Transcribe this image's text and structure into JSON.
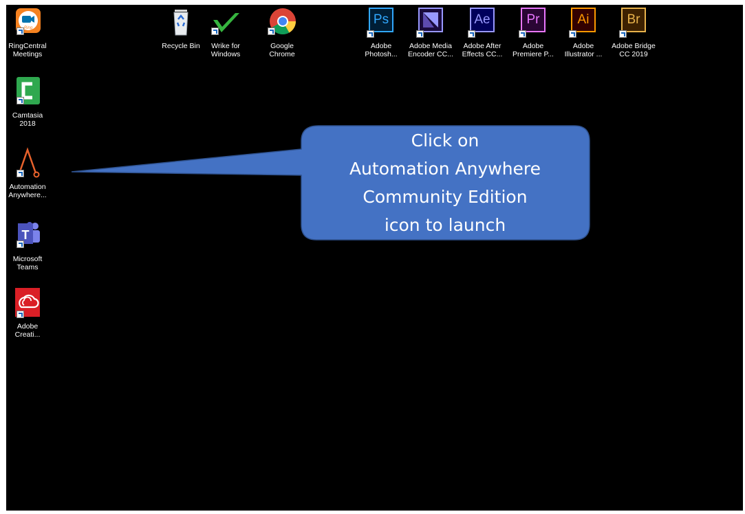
{
  "desktop": {
    "left_icons": [
      {
        "label": "RingCentral\nMeetings",
        "icon": "ringcentral-meetings-icon"
      },
      {
        "label": "Camtasia\n2018",
        "icon": "camtasia-icon"
      },
      {
        "label": "Automation\nAnywhere...",
        "icon": "automation-anywhere-icon"
      },
      {
        "label": "Microsoft\nTeams",
        "icon": "microsoft-teams-icon"
      },
      {
        "label": "Adobe\nCreati...",
        "icon": "adobe-creative-cloud-icon"
      }
    ],
    "top_icons": [
      {
        "label": "Recycle Bin",
        "icon": "recycle-bin-icon"
      },
      {
        "label": "Wrike for\nWindows",
        "icon": "wrike-icon"
      },
      {
        "label": "Google\nChrome",
        "icon": "google-chrome-icon"
      },
      {
        "label": "Adobe\nPhotosh...",
        "icon": "adobe-photoshop-icon",
        "badge": "Ps",
        "color": "#31a8ff"
      },
      {
        "label": "Adobe Media\nEncoder CC...",
        "icon": "adobe-media-encoder-icon",
        "badge": "",
        "color": "#9999ff"
      },
      {
        "label": "Adobe After\nEffects CC...",
        "icon": "adobe-after-effects-icon",
        "badge": "Ae",
        "color": "#9999ff"
      },
      {
        "label": "Adobe\nPremiere P...",
        "icon": "adobe-premiere-icon",
        "badge": "Pr",
        "color": "#ea77ff"
      },
      {
        "label": "Adobe\nIllustrator ...",
        "icon": "adobe-illustrator-icon",
        "badge": "Ai",
        "color": "#ff9a00"
      },
      {
        "label": "Adobe Bridge\nCC 2019",
        "icon": "adobe-bridge-icon",
        "badge": "Br",
        "color": "#e8b34c"
      }
    ]
  },
  "callout": {
    "text": "Click on\nAutomation Anywhere\nCommunity Edition\nicon to launch",
    "fill": "#4472c4",
    "stroke": "#2f528f"
  },
  "colors": {
    "desktop_bg": "#000000",
    "frame": "#ffffff"
  }
}
